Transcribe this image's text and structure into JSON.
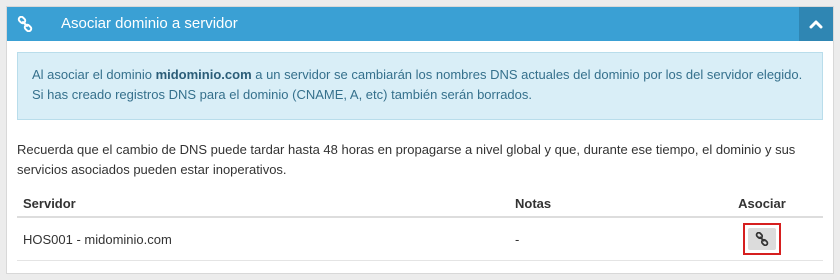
{
  "header": {
    "title": "Asociar dominio a servidor",
    "link_icon": "link-icon",
    "collapse_icon": "chevron-up-icon"
  },
  "alert": {
    "prefix": "Al asociar el dominio ",
    "domain": "midominio.com",
    "suffix": " a un servidor se cambiarán los nombres DNS actuales del dominio por los del servidor elegido. Si has creado registros DNS para el dominio (CNAME, A, etc) también serán borrados."
  },
  "info": "Recuerda que el cambio de DNS puede tardar hasta 48 horas en propagarse a nivel global y que, durante ese tiempo, el dominio y sus servicios asociados pueden estar inoperativos.",
  "table": {
    "headers": {
      "servidor": "Servidor",
      "notas": "Notas",
      "asociar": "Asociar"
    },
    "rows": [
      {
        "servidor": "HOS001 - midominio.com",
        "notas": "-",
        "action_icon": "link-icon"
      }
    ]
  },
  "colors": {
    "header_bg": "#3aa0d4",
    "collapse_bg": "#2f86b3",
    "alert_bg": "#d9eef7",
    "alert_text": "#35708c",
    "highlight": "#d61f1f"
  }
}
